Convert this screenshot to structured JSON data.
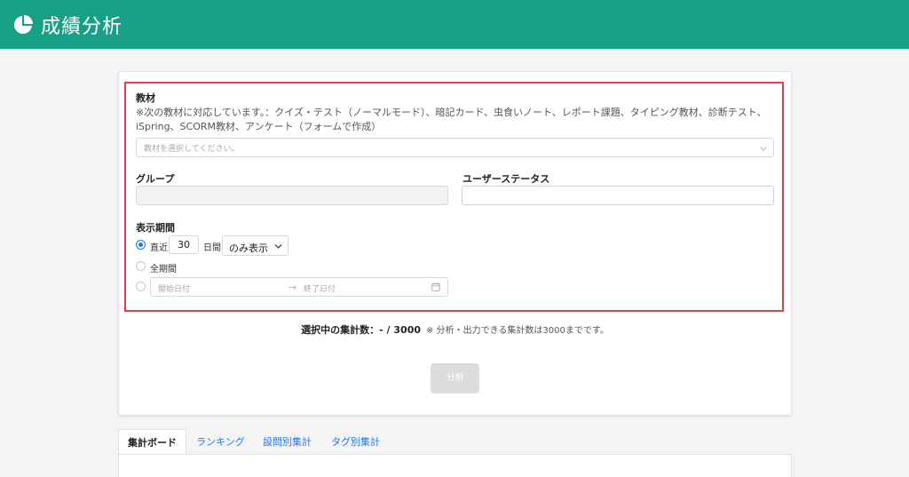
{
  "header": {
    "title": "成績分析",
    "logo_icon": "pie-chart-icon",
    "color": "#17a086"
  },
  "material": {
    "label": "教材",
    "note_line1": "※次の教材に対応しています。：クイズ・テスト（ノーマルモード）、暗記カード、虫食いノート、レポート課題、タイピング教材、診断テスト、",
    "note_line2": "iSpring、SCORM教材、アンケート（フォームで作成）",
    "placeholder": "教材を選択してください。"
  },
  "group": {
    "label": "グループ"
  },
  "user_status": {
    "label": "ユーザーステータス"
  },
  "period": {
    "label": "表示期間",
    "recent_label": "直近",
    "recent_days": "30",
    "days_unit": "日間",
    "mode_value": "のみ表示",
    "all_label": "全期間",
    "start_placeholder": "開始日付",
    "end_placeholder": "終了日付",
    "selected": "recent"
  },
  "count": {
    "label": "選択中の集計数：- / 3000",
    "note": "※ 分析・出力できる集計数は3000までです。"
  },
  "analyze_button": "分析",
  "tabs": [
    {
      "label": "集計ボード",
      "active": true
    },
    {
      "label": "ランキング",
      "active": false
    },
    {
      "label": "設問別集計",
      "active": false
    },
    {
      "label": "タグ別集計",
      "active": false
    }
  ],
  "colors": {
    "accent": "#1677ff",
    "highlight": "#e24044",
    "disabled_button": "#dcdcdc"
  }
}
